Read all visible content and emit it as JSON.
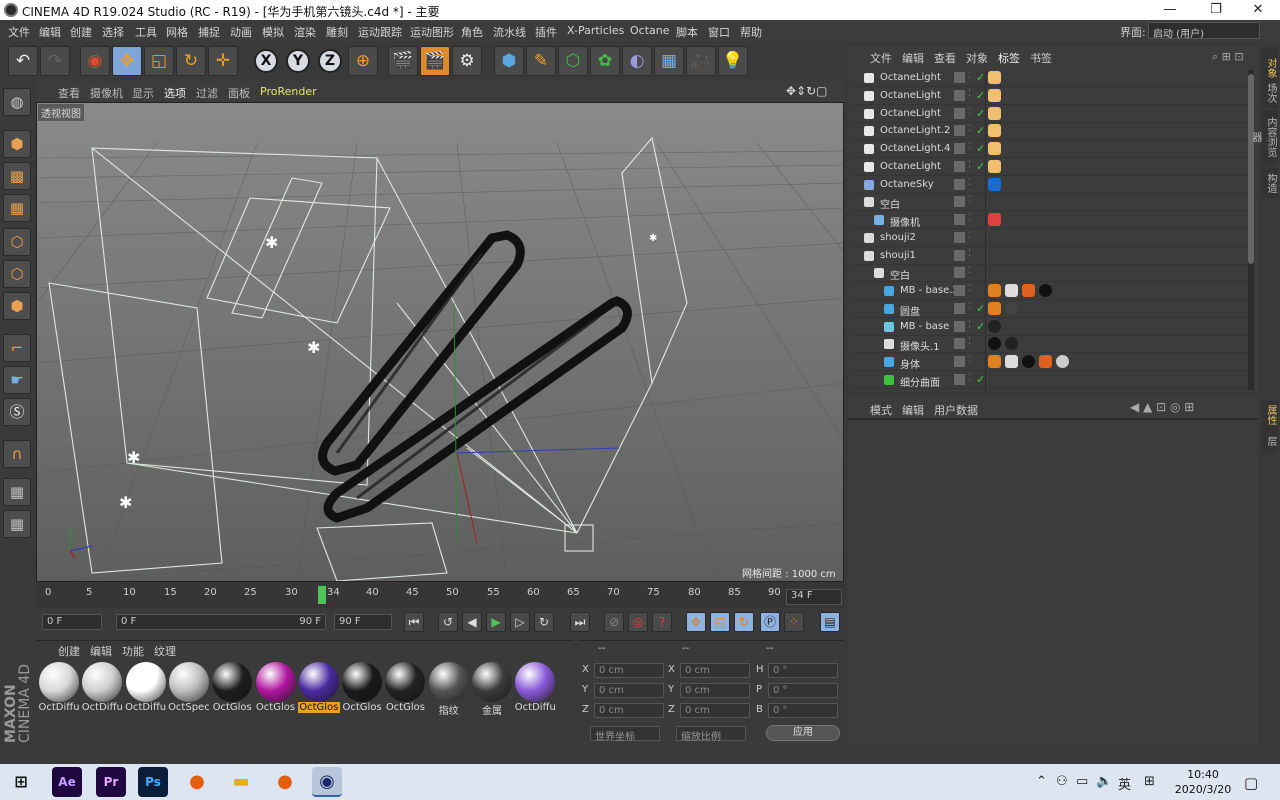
{
  "window": {
    "title": "CINEMA 4D R19.024 Studio (RC - R19) - [华为手机第六镜头.c4d *] - 主要",
    "buttons": [
      "—",
      "❐",
      "✕"
    ]
  },
  "menubar": {
    "items": [
      "文件",
      "编辑",
      "创建",
      "选择",
      "工具",
      "网格",
      "捕捉",
      "动画",
      "模拟",
      "渲染",
      "雕刻",
      "运动跟踪",
      "运动图形",
      "角色",
      "流水线",
      "插件",
      "X-Particles",
      "Octane",
      "脚本",
      "窗口",
      "帮助"
    ],
    "layout_label": "界面:",
    "layout_value": "启动 (用户)"
  },
  "viewport": {
    "menu": [
      "查看",
      "摄像机",
      "显示",
      "选项",
      "过滤",
      "面板",
      "ProRender"
    ],
    "label": "透视视图",
    "grid_spacing": "网格间距 : 1000 cm"
  },
  "timeline": {
    "ticks": [
      "0",
      "5",
      "10",
      "15",
      "20",
      "25",
      "30",
      "34",
      "40",
      "45",
      "50",
      "55",
      "60",
      "65",
      "70",
      "75",
      "80",
      "85",
      "90"
    ],
    "current_frame": "34 F",
    "start": "0 F",
    "range_start": "0 F",
    "range_end": "90 F",
    "end": "90 F",
    "playhead_fraction": 0.378
  },
  "materials": {
    "tabs": [
      "创建",
      "编辑",
      "功能",
      "纹理"
    ],
    "items": [
      {
        "label": "OctDiffu",
        "color": "#d8d8d8",
        "selected": false
      },
      {
        "label": "OctDiffu",
        "color": "#cfcfcf",
        "selected": false
      },
      {
        "label": "OctDiffu",
        "color": "#ffffff",
        "selected": false
      },
      {
        "label": "OctSpec",
        "color": "#bfbfbf",
        "selected": false
      },
      {
        "label": "OctGlos",
        "color": "#1e1e1e",
        "selected": false
      },
      {
        "label": "OctGlos",
        "color": "#b0179f",
        "selected": false
      },
      {
        "label": "OctGlos",
        "color": "#4a2aa0",
        "selected": true
      },
      {
        "label": "OctGlos",
        "color": "#1a1a1a",
        "selected": false
      },
      {
        "label": "OctGlos",
        "color": "#222222",
        "selected": false
      },
      {
        "label": "指纹",
        "color": "#555555",
        "selected": false
      },
      {
        "label": "金属",
        "color": "#3c3c3c",
        "selected": false
      },
      {
        "label": "OctDiffu",
        "color": "#8a5ad8",
        "selected": false
      }
    ]
  },
  "coords": {
    "header": [
      "--",
      "--",
      "--"
    ],
    "rows": [
      {
        "a": "X",
        "av": "0 cm",
        "b": "X",
        "bv": "0 cm",
        "c": "H",
        "cv": "0 °"
      },
      {
        "a": "Y",
        "av": "0 cm",
        "b": "Y",
        "bv": "0 cm",
        "c": "P",
        "cv": "0 °"
      },
      {
        "a": "Z",
        "av": "0 cm",
        "b": "Z",
        "bv": "0 cm",
        "c": "B",
        "cv": "0 °"
      }
    ],
    "world": "世界坐标",
    "scale": "缩放比例",
    "apply": "应用"
  },
  "object_manager": {
    "tabs": [
      "文件",
      "编辑",
      "查看",
      "对象",
      "标签",
      "书签"
    ],
    "rows": [
      {
        "name": "OctaneLight",
        "icon": "light-icon",
        "check": true
      },
      {
        "name": "OctaneLight",
        "icon": "light-icon",
        "check": true
      },
      {
        "name": "OctaneLight",
        "icon": "light-icon",
        "check": true
      },
      {
        "name": "OctaneLight.2",
        "icon": "light-icon",
        "check": true
      },
      {
        "name": "OctaneLight.4",
        "icon": "light-icon",
        "check": true
      },
      {
        "name": "OctaneLight",
        "icon": "light-icon",
        "check": true
      },
      {
        "name": "OctaneSky",
        "icon": "sky-icon",
        "check": false
      },
      {
        "name": "空白",
        "icon": "null-icon",
        "check": false
      },
      {
        "name": "摄像机",
        "icon": "camera-icon",
        "check": false
      },
      {
        "name": "shouji2",
        "icon": "null-icon",
        "check": false
      },
      {
        "name": "shouji1",
        "icon": "null-icon",
        "check": false
      },
      {
        "name": "空白",
        "icon": "null-icon",
        "check": false
      },
      {
        "name": "MB - base.2",
        "icon": "poly-icon",
        "check": false
      },
      {
        "name": "圆盘",
        "icon": "disc-icon",
        "check": true
      },
      {
        "name": "MB - base",
        "icon": "sym-icon",
        "check": true
      },
      {
        "name": "摄像头.1",
        "icon": "null-icon",
        "check": false
      },
      {
        "name": "身体",
        "icon": "poly-icon",
        "check": false
      },
      {
        "name": "细分曲面",
        "icon": "subdiv-icon",
        "check": true
      }
    ]
  },
  "attribute_manager": {
    "tabs": [
      "模式",
      "编辑",
      "用户数据"
    ]
  },
  "side_tabs": [
    "对象",
    "场次",
    "内容浏览器",
    "构造",
    "属性",
    "层"
  ],
  "taskbar": {
    "apps": [
      "Ae",
      "Pr",
      "Ps"
    ],
    "ime": "英",
    "time": "10:40",
    "date": "2020/3/20"
  }
}
